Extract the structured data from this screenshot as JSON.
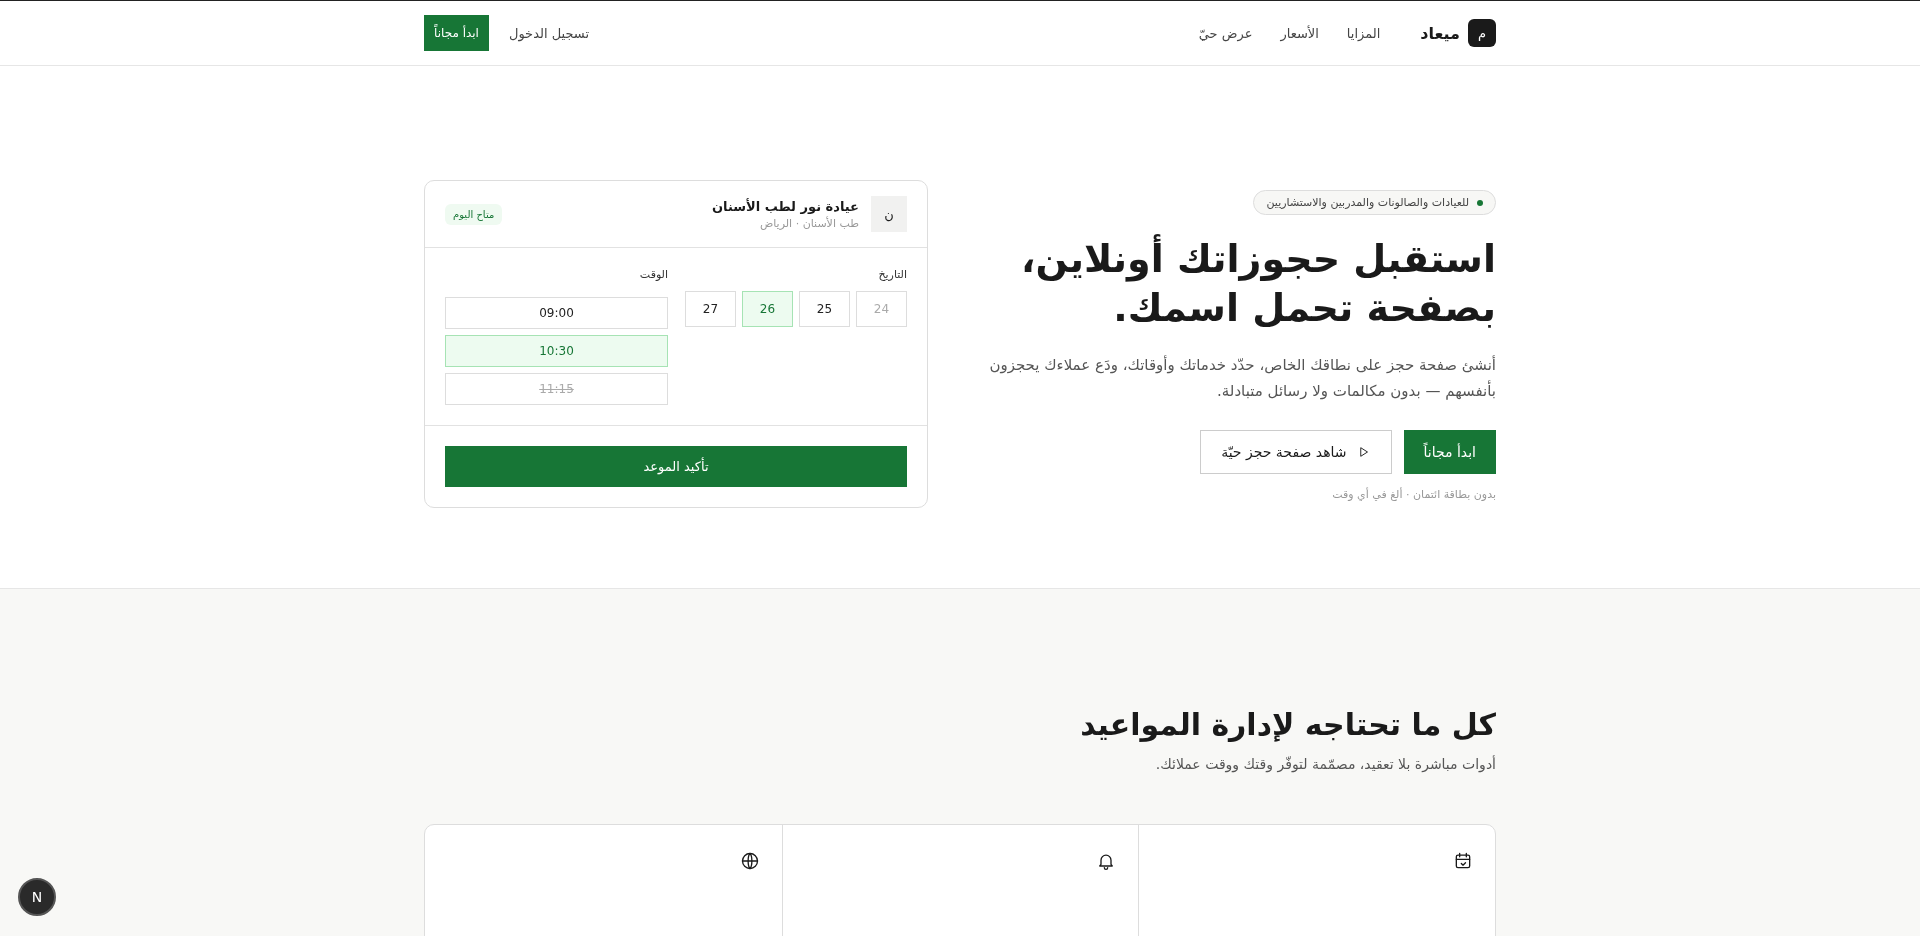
{
  "header": {
    "logo": {
      "mark": "م",
      "name": "ميعاد"
    },
    "nav": [
      "المزايا",
      "الأسعار",
      "عرض حيّ"
    ],
    "login": "تسجيل الدخول",
    "cta": "ابدأ مجاناً"
  },
  "hero": {
    "badge": "للعيادات والصالونات والمدربين والاستشاريين",
    "title": "استقبل حجوزاتك أونلاين، بصفحة تحمل اسمك.",
    "description": "أنشئ صفحة حجز على نطاقك الخاص، حدّد خدماتك وأوقاتك، ودَع عملاءك يحجزون بأنفسهم — بدون مكالمات ولا رسائل متبادلة.",
    "primary_button": "ابدأ مجاناً",
    "secondary_button": "شاهد صفحة حجز حيّة",
    "note": "بدون بطاقة ائتمان · ألغ في أي وقت"
  },
  "booking_card": {
    "avatar": "ن",
    "clinic": "عيادة نور لطب الأسنان",
    "subtitle": "طب الأسنان · الرياض",
    "status": "متاح اليوم",
    "date_label": "التاريخ",
    "dates": [
      {
        "label": "24",
        "selected": false,
        "disabled": true
      },
      {
        "label": "25",
        "selected": false,
        "disabled": false
      },
      {
        "label": "26",
        "selected": true,
        "disabled": false
      },
      {
        "label": "27",
        "selected": false,
        "disabled": false
      }
    ],
    "time_label": "الوقت",
    "times": [
      {
        "label": "09:00",
        "selected": false,
        "disabled": false
      },
      {
        "label": "10:30",
        "selected": true,
        "disabled": false
      },
      {
        "label": "11:15",
        "selected": false,
        "disabled": true
      }
    ],
    "confirm": "تأكيد الموعد"
  },
  "features": {
    "title": "كل ما تحتاجه لإدارة المواعيد",
    "subtitle": "أدوات مباشرة بلا تعقيد، مصمّمة لتوفّر وقتك ووقت عملائك.",
    "cards": [
      {
        "kind": "calendar"
      },
      {
        "kind": "bell"
      },
      {
        "kind": "globe"
      }
    ]
  },
  "dev_badge": {
    "label": "N"
  }
}
